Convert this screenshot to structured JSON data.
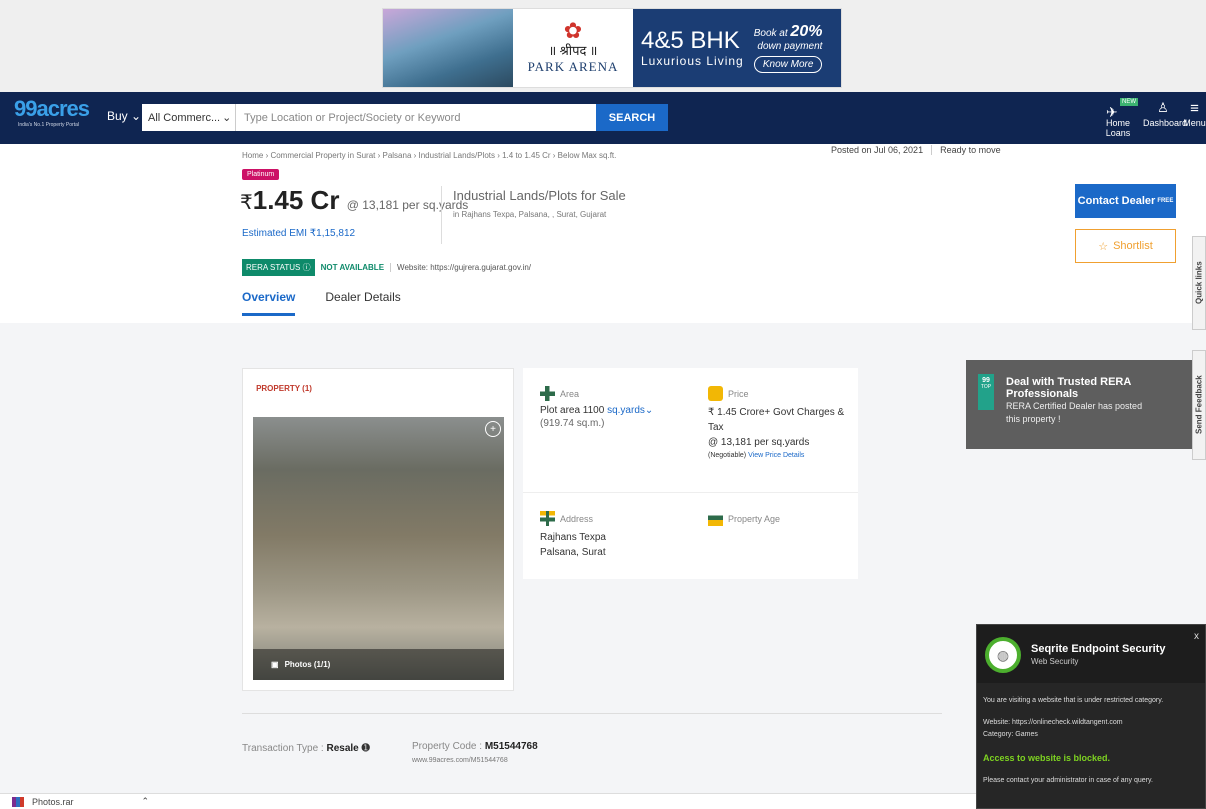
{
  "ad": {
    "hindi": "॥ श्रीपद ॥",
    "project": "PARK ARENA",
    "bhk": "4&5 BHK",
    "tagline": "Luxurious Living",
    "book": "Book at",
    "pct": "20%",
    "down": "down payment",
    "cta": "Know More"
  },
  "nav": {
    "brand": "99acres",
    "brand_tag": "India's No.1 Property Portal",
    "buy": "Buy",
    "category": "All Commerc...",
    "search_placeholder": "Type Location or Project/Society or Keyword",
    "search_btn": "SEARCH",
    "new_badge": "NEW",
    "home_loans": "Home Loans",
    "dashboard": "Dashboard",
    "menu": "Menu"
  },
  "listing": {
    "breadcrumb": "Home › Commercial Property in Surat › Palsana › Industrial Lands/Plots › 1.4 to 1.45 Cr › Below Max sq.ft.",
    "posted": "Posted on Jul 06, 2021",
    "ready": "Ready to move",
    "badge": "Platinum",
    "rupee": "₹",
    "price": "1.45 Cr",
    "per_unit": "@ 13,181 per sq.yards",
    "emi": "Estimated EMI ₹1,15,812",
    "type": "Industrial Lands/Plots for Sale",
    "location": "in Rajhans Texpa, Palsana, , Surat, Gujarat",
    "rera_status": "RERA STATUS",
    "rera_value": "NOT AVAILABLE",
    "rera_website": "Website: https://gujrera.gujarat.gov.in/",
    "tabs": [
      "Overview",
      "Dealer Details"
    ],
    "contact": "Contact Dealer",
    "contact_sup": "FREE",
    "shortlist": "Shortlist"
  },
  "photo": {
    "tab": "PROPERTY (1)",
    "photos": "Photos (1/1)"
  },
  "details": {
    "area_label": "Area",
    "area_value": "Plot area 1100",
    "area_unit": "sq.yards",
    "area_sqm": "(919.74 sq.m.)",
    "price_label": "Price",
    "price_value": "₹ 1.45 Crore+ Govt Charges & Tax",
    "price_per": "@ 13,181 per sq.yards",
    "negotiable": "(Negotiable)",
    "price_link": "View Price Details",
    "address_label": "Address",
    "address_1": "Rajhans Texpa",
    "address_2": "Palsana, Surat",
    "age_label": "Property Age"
  },
  "rera_box": {
    "badge": "99",
    "badge_sub": "TOP",
    "title": "Deal with Trusted RERA Professionals",
    "text": "RERA Certified Dealer has posted this property !"
  },
  "side": {
    "quick": "Quick links",
    "feedback": "Send Feedback"
  },
  "bottom": {
    "trans_label": "Transaction Type : ",
    "trans_value": "Resale",
    "code_label": "Property Code : ",
    "code_value": "M51544768",
    "code_url": "www.99acres.com/M51544768"
  },
  "download": {
    "file": "Photos.rar"
  },
  "seqrite": {
    "title": "Seqrite Endpoint Security",
    "subtitle": "Web Security",
    "close": "x",
    "msg": "You are visiting a website that is under restricted category.",
    "website": "Website: https://onlinecheck.wildtangent.com",
    "category": "Category: Games",
    "blocked": "Access to website is blocked.",
    "contact": "Please contact your administrator in case of any query."
  }
}
